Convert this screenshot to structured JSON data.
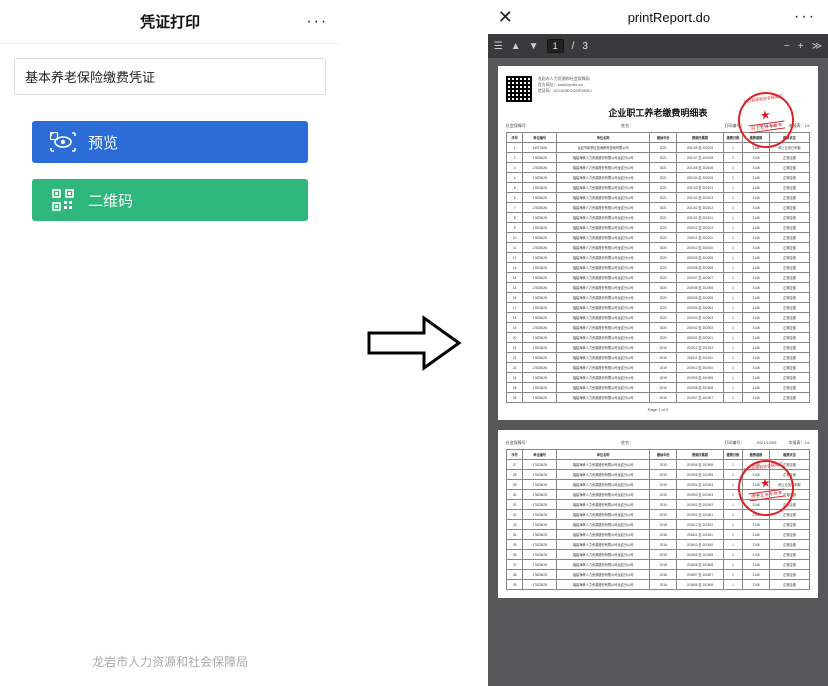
{
  "left": {
    "title": "凭证打印",
    "menu_dots": "···",
    "insurance_type": "基本养老保险缴费凭证",
    "preview_btn": "预览",
    "qr_btn": "二维码",
    "footer": "龙岩市人力资源和社会保障局"
  },
  "arrow": {
    "name": "arrow-right"
  },
  "right": {
    "close": "✕",
    "title": "printReport.do",
    "menu_dots": "···",
    "toolbar": {
      "page_current": "1",
      "page_total": "3",
      "separator": "/"
    },
    "document": {
      "title": "企业职工养老缴费明细表",
      "qr_line1": "龙岩市人力资源和社会保障局",
      "qr_line2": "官方网址：www.lyrsks.cn",
      "qr_line3": "验证码：AC0D8KOQGPSBNJ",
      "meta_labels": {
        "unit": "社会保障号：",
        "name": "姓名：",
        "print_no": "打印编号：",
        "print_date": "2021/12/06",
        "page": "本报表：1/1"
      },
      "columns": [
        "序号",
        "单位编号",
        "单位名称",
        "缴纳年份",
        "费款所属期",
        "缴费月数",
        "缴费基数",
        "缴费状态"
      ],
      "rows_page1": [
        [
          "1",
          "14973408",
          "龙岩市新罗区蓝海教育咨询有限公司",
          "2021",
          "202109 至 202109",
          "1",
          "2148",
          "网上业务已申报"
        ],
        [
          "2",
          "17823628",
          "福建海峡人力资源股份有限公司龙岩分公司",
          "2021",
          "202107 至 202108",
          "2",
          "2148",
          "正常应缴"
        ],
        [
          "3",
          "17823628",
          "福建海峡人力资源股份有限公司龙岩分公司",
          "2021",
          "202106 至 202106",
          "1",
          "2148",
          "正常应缴"
        ],
        [
          "4",
          "17823628",
          "福建海峡人力资源股份有限公司龙岩分公司",
          "2021",
          "202104 至 202105",
          "2",
          "2148",
          "正常应缴"
        ],
        [
          "5",
          "17823628",
          "福建海峡人力资源股份有限公司龙岩分公司",
          "2021",
          "202103 至 202104",
          "1",
          "2148",
          "正常应缴"
        ],
        [
          "6",
          "17823628",
          "福建海峡人力资源股份有限公司龙岩分公司",
          "2021",
          "202102 至 202103",
          "1",
          "2148",
          "正常应缴"
        ],
        [
          "7",
          "17823628",
          "福建海峡人力资源股份有限公司龙岩分公司",
          "2021",
          "202102 至 202102",
          "1",
          "2148",
          "正常应缴"
        ],
        [
          "8",
          "17823628",
          "福建海峡人力资源股份有限公司龙岩分公司",
          "2021",
          "202101 至 202101",
          "1",
          "2148",
          "正常应缴"
        ],
        [
          "9",
          "17823628",
          "福建海峡人力资源股份有限公司龙岩分公司",
          "2020",
          "202012 至 202012",
          "1",
          "2148",
          "正常应缴"
        ],
        [
          "10",
          "17823628",
          "福建海峡人力资源股份有限公司龙岩分公司",
          "2020",
          "202011 至 202011",
          "1",
          "2148",
          "正常应缴"
        ],
        [
          "11",
          "17823628",
          "福建海峡人力资源股份有限公司龙岩分公司",
          "2020",
          "202010 至 202010",
          "1",
          "2148",
          "正常应缴"
        ],
        [
          "12",
          "17823628",
          "福建海峡人力资源股份有限公司龙岩分公司",
          "2020",
          "202009 至 202009",
          "1",
          "2148",
          "正常应缴"
        ],
        [
          "13",
          "17823628",
          "福建海峡人力资源股份有限公司龙岩分公司",
          "2020",
          "202008 至 202008",
          "1",
          "2148",
          "正常应缴"
        ],
        [
          "14",
          "17823628",
          "福建海峡人力资源股份有限公司龙岩分公司",
          "2020",
          "202007 至 202007",
          "1",
          "2148",
          "正常应缴"
        ],
        [
          "15",
          "17823628",
          "福建海峡人力资源股份有限公司龙岩分公司",
          "2020",
          "202006 至 202006",
          "1",
          "2148",
          "正常应缴"
        ],
        [
          "16",
          "17823628",
          "福建海峡人力资源股份有限公司龙岩分公司",
          "2020",
          "202005 至 202005",
          "1",
          "2148",
          "正常应缴"
        ],
        [
          "17",
          "17823628",
          "福建海峡人力资源股份有限公司龙岩分公司",
          "2020",
          "202004 至 202004",
          "1",
          "2148",
          "正常应缴"
        ],
        [
          "18",
          "17823628",
          "福建海峡人力资源股份有限公司龙岩分公司",
          "2020",
          "202003 至 202003",
          "1",
          "2148",
          "正常应缴"
        ],
        [
          "19",
          "17823628",
          "福建海峡人力资源股份有限公司龙岩分公司",
          "2020",
          "202002 至 202002",
          "1",
          "2148",
          "正常应缴"
        ],
        [
          "20",
          "17823628",
          "福建海峡人力资源股份有限公司龙岩分公司",
          "2020",
          "202001 至 202001",
          "1",
          "2148",
          "正常应缴"
        ],
        [
          "21",
          "17823628",
          "福建海峡人力资源股份有限公司龙岩分公司",
          "2019",
          "201912 至 201912",
          "1",
          "2148",
          "正常应缴"
        ],
        [
          "22",
          "17823628",
          "福建海峡人力资源股份有限公司龙岩分公司",
          "2019",
          "201911 至 201911",
          "1",
          "2148",
          "正常应缴"
        ],
        [
          "23",
          "17823628",
          "福建海峡人力资源股份有限公司龙岩分公司",
          "2019",
          "201910 至 201910",
          "1",
          "2148",
          "正常应缴"
        ],
        [
          "24",
          "17823628",
          "福建海峡人力资源股份有限公司龙岩分公司",
          "2019",
          "201909 至 201909",
          "1",
          "2148",
          "正常应缴"
        ],
        [
          "25",
          "17823628",
          "福建海峡人力资源股份有限公司龙岩分公司",
          "2019",
          "201908 至 201908",
          "1",
          "2148",
          "正常应缴"
        ],
        [
          "26",
          "17823628",
          "福建海峡人力资源股份有限公司龙岩分公司",
          "2019",
          "201907 至 201907",
          "1",
          "2148",
          "正常应缴"
        ]
      ],
      "page1_footer": "Page 1 of 3",
      "rows_page2": [
        [
          "27",
          "17823628",
          "福建海峡人力资源股份有限公司龙岩分公司",
          "2019",
          "201906 至 201906",
          "1",
          "2148",
          "正常应缴"
        ],
        [
          "28",
          "17823628",
          "福建海峡人力资源股份有限公司龙岩分公司",
          "2019",
          "201905 至 201905",
          "1",
          "2148",
          "正常应缴"
        ],
        [
          "29",
          "17823628",
          "福建海峡人力资源股份有限公司龙岩分公司",
          "2019",
          "201904 至 201904",
          "1",
          "2148",
          "网上业务已申报"
        ],
        [
          "30",
          "17823628",
          "福建海峡人力资源股份有限公司龙岩分公司",
          "2019",
          "201903 至 201903",
          "1",
          "2148",
          "正常应缴"
        ],
        [
          "31",
          "17823628",
          "福建海峡人力资源股份有限公司龙岩分公司",
          "2019",
          "201902 至 201902",
          "1",
          "2148",
          "正常应缴"
        ],
        [
          "32",
          "17823628",
          "福建海峡人力资源股份有限公司龙岩分公司",
          "2019",
          "201901 至 201901",
          "1",
          "2148",
          "正常应缴"
        ],
        [
          "33",
          "17823628",
          "福建海峡人力资源股份有限公司龙岩分公司",
          "2018",
          "201812 至 201812",
          "1",
          "2148",
          "正常应缴"
        ],
        [
          "34",
          "17823628",
          "福建海峡人力资源股份有限公司龙岩分公司",
          "2018",
          "201811 至 201811",
          "1",
          "2148",
          "正常应缴"
        ],
        [
          "35",
          "17823628",
          "福建海峡人力资源股份有限公司龙岩分公司",
          "2018",
          "201810 至 201810",
          "1",
          "2148",
          "正常应缴"
        ],
        [
          "36",
          "17823628",
          "福建海峡人力资源股份有限公司龙岩分公司",
          "2018",
          "201809 至 201809",
          "1",
          "2148",
          "正常应缴"
        ],
        [
          "37",
          "17823628",
          "福建海峡人力资源股份有限公司龙岩分公司",
          "2018",
          "201808 至 201808",
          "1",
          "2148",
          "正常应缴"
        ],
        [
          "38",
          "17823628",
          "福建海峡人力资源股份有限公司龙岩分公司",
          "2018",
          "201807 至 201807",
          "1",
          "2148",
          "正常应缴"
        ],
        [
          "39",
          "17823628",
          "福建海峡人力资源股份有限公司龙岩分公司",
          "2018",
          "201806 至 201806",
          "1",
          "2148",
          "正常应缴"
        ]
      ],
      "stamp_top": "人力资源和社会保障局",
      "stamp_bottom": "网上业务专用章"
    }
  }
}
